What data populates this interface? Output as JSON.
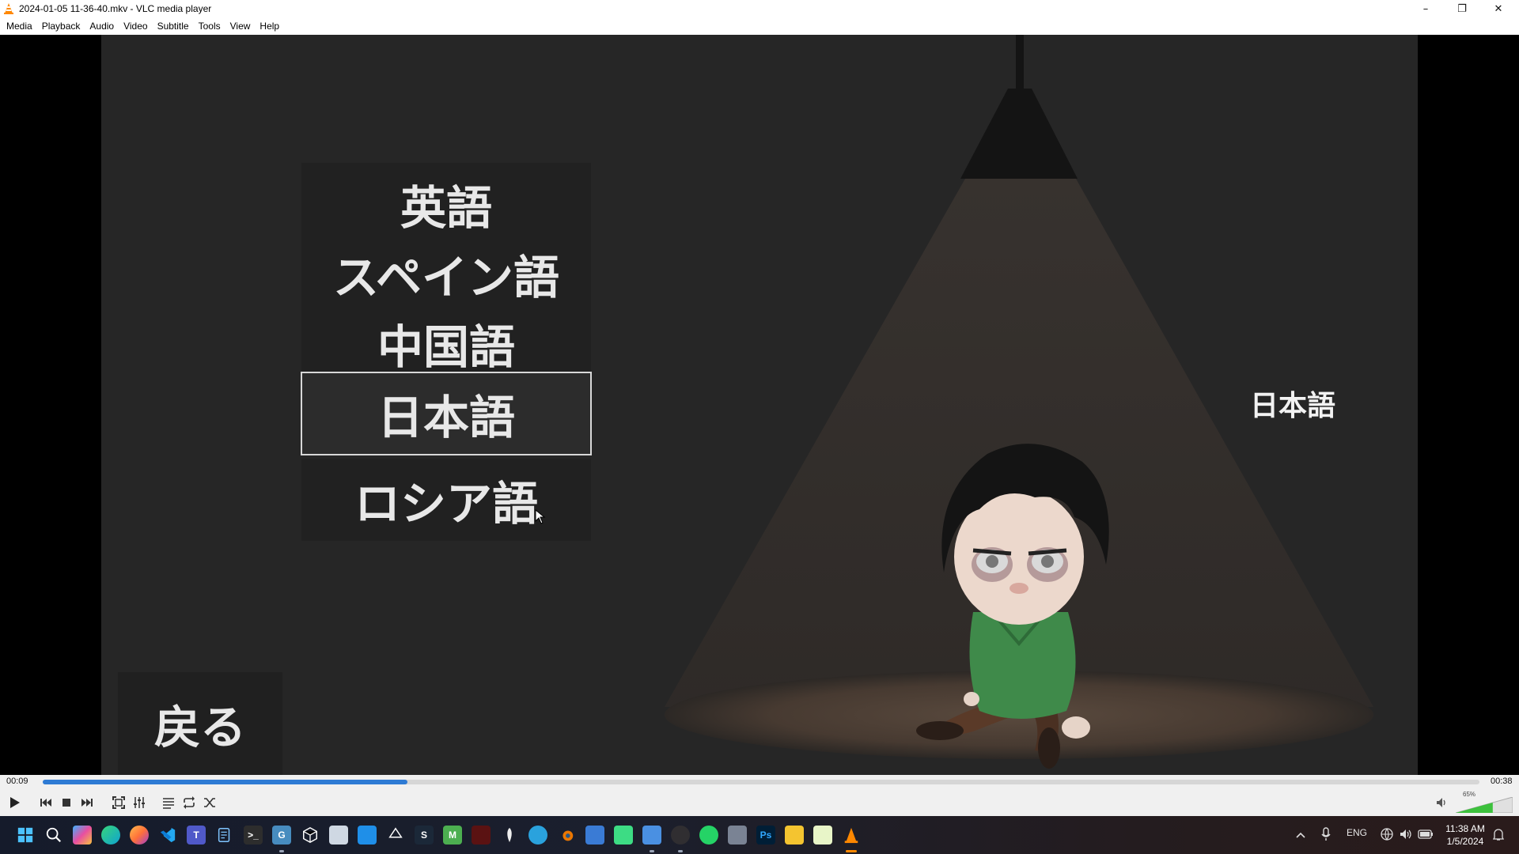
{
  "window": {
    "title": "2024-01-05 11-36-40.mkv - VLC media player",
    "controls": {
      "minimize": "–",
      "restore": "❐",
      "close": "✕"
    }
  },
  "menu": [
    "Media",
    "Playback",
    "Audio",
    "Video",
    "Subtitle",
    "Tools",
    "View",
    "Help"
  ],
  "video": {
    "language_options": [
      "英語",
      "スペイン語",
      "中国語",
      "日本語",
      "ロシア語"
    ],
    "selected_index": 3,
    "back_label": "戻る",
    "current_language": "日本語"
  },
  "playback": {
    "elapsed": "00:09",
    "total": "00:38",
    "progress_fraction": 0.254,
    "volume_label": "65%",
    "volume_fraction": 0.65
  },
  "toolbar_icons": [
    "play-icon",
    "previous-icon",
    "stop-icon",
    "next-icon",
    "fullscreen-icon",
    "extended-settings-icon",
    "playlist-icon",
    "loop-icon",
    "shuffle-icon",
    "volume-icon"
  ],
  "taskbar": {
    "icons": [
      "windows-start-icon",
      "search-icon",
      "copilot-icon",
      "edge-icon",
      "firefox-icon",
      "vscode-icon",
      "teams-icon",
      "notepad-icon",
      "terminal-icon",
      "godot-icon",
      "box-3d-icon",
      "cube-icon",
      "store-icon",
      "unity-icon",
      "steam-icon",
      "minecraft-icon",
      "game-icon",
      "feather-icon",
      "telegram-icon",
      "blender-icon",
      "office-icon",
      "android-studio-icon",
      "pocket-icon",
      "obs-icon",
      "whatsapp-icon",
      "cloud-icon",
      "photoshop-icon",
      "file-explorer-icon",
      "spreadsheet-icon",
      "vlc-icon"
    ],
    "tray": {
      "language": "ENG",
      "time": "11:38 AM",
      "date": "1/5/2024"
    },
    "colors": {
      "photoshop": "#31a8ff",
      "whatsapp": "#25d366",
      "vlc": "#ff8800",
      "firefox": "#ff7139",
      "edge": "#0fa3d1",
      "vscode": "#23a9f2"
    }
  }
}
